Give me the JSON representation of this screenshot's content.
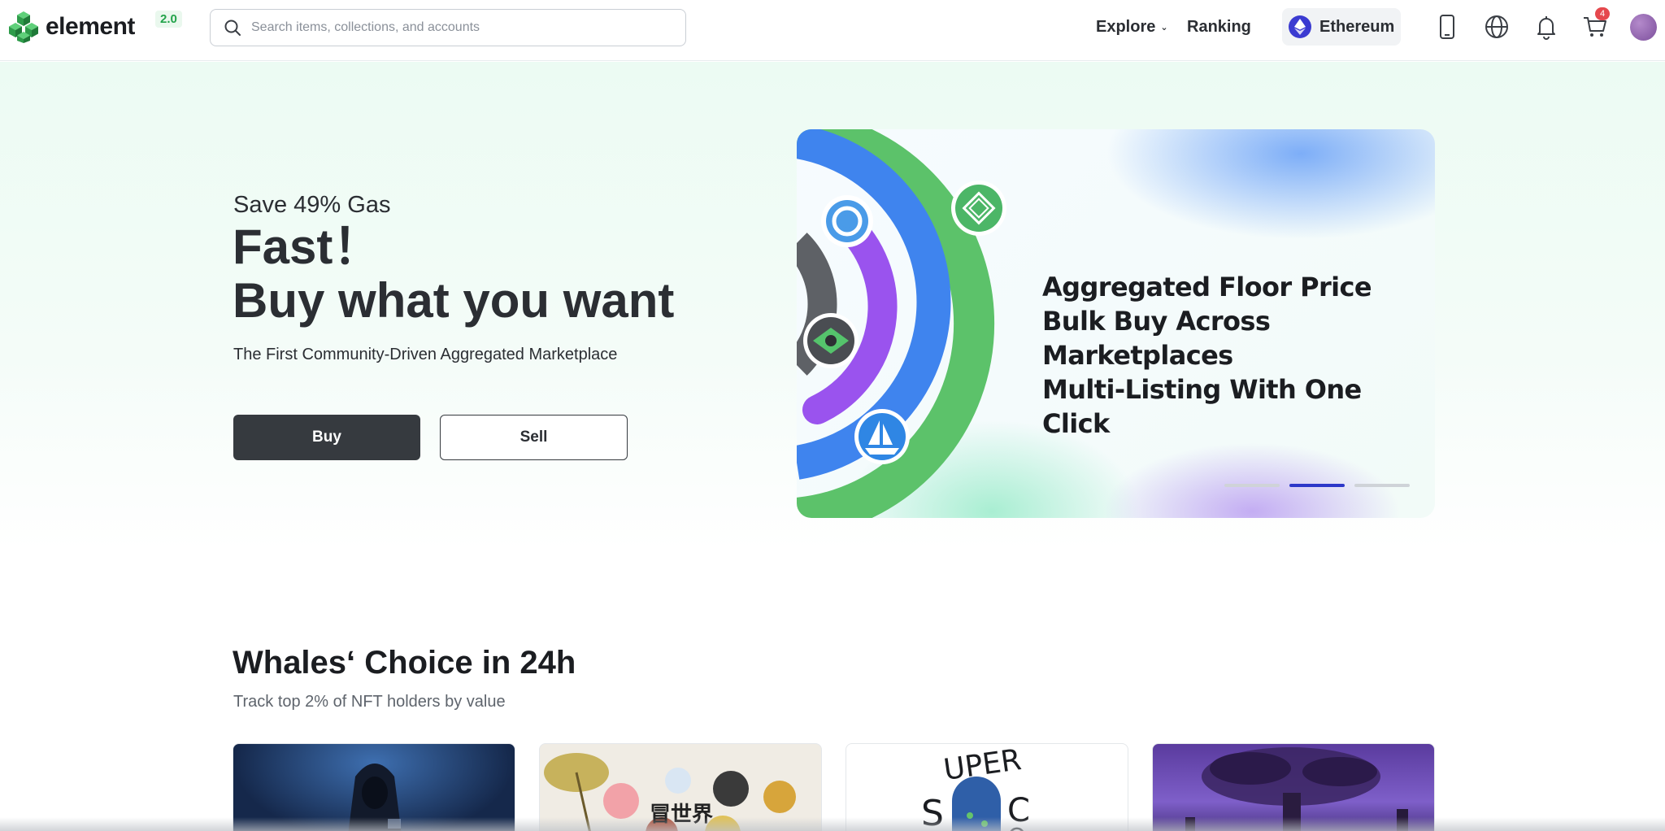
{
  "header": {
    "logo_text": "element",
    "version_badge": "2.0",
    "search_placeholder": "Search items, collections, and accounts",
    "nav": {
      "explore": "Explore",
      "ranking": "Ranking"
    },
    "chain": "Ethereum",
    "cart_count": "4",
    "icons": [
      "mobile-icon",
      "globe-icon",
      "bell-icon",
      "cart-icon",
      "avatar"
    ]
  },
  "hero": {
    "eyebrow": "Save 49% Gas",
    "title_line1": "Fast！",
    "title_line2": "Buy what you want",
    "subtitle": "The First Community-Driven Aggregated Marketplace",
    "buy_label": "Buy",
    "sell_label": "Sell",
    "banner": {
      "line1": "Aggregated Floor Price",
      "line2": "Bulk Buy Across Marketplaces",
      "line3": "Multi-Listing With One Click",
      "slides": 3,
      "active_slide": 2
    }
  },
  "whales": {
    "title": "Whales‘ Choice in 24h",
    "subtitle": "Track top 2% of NFT holders by value",
    "cards": [
      {
        "name": "hooded-figure-collection"
      },
      {
        "name": "anime-characters-collection",
        "caption": "冒世界"
      },
      {
        "name": "super-collection",
        "caption": "SUPER S CO"
      },
      {
        "name": "tree-world-collection"
      }
    ]
  },
  "colors": {
    "accent_green": "#22a34a",
    "dark_button": "#363a3f",
    "eth_blue": "#3b3bd1",
    "active_dot": "#2d38c9",
    "badge_red": "#e5484d"
  }
}
